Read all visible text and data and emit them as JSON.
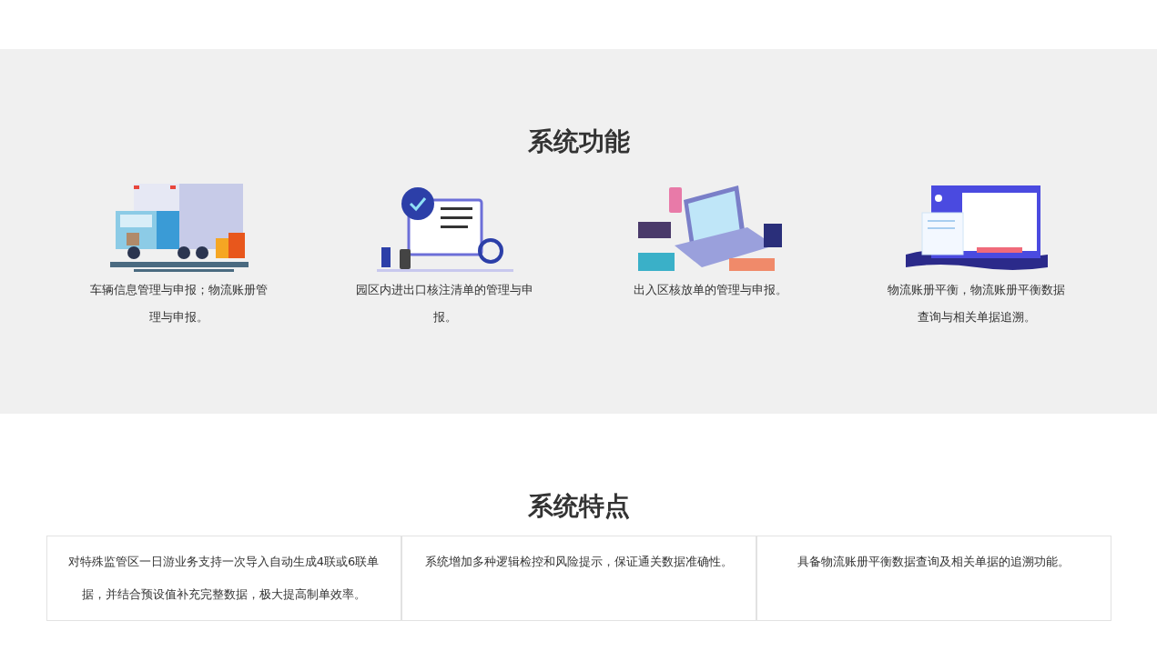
{
  "functions": {
    "title": "系统功能",
    "items": [
      {
        "kind": "truck",
        "text": "车辆信息管理与申报；物流账册管理与申报。"
      },
      {
        "kind": "checklist",
        "text": "园区内进出口核注清单的管理与申报。"
      },
      {
        "kind": "laptop",
        "text": "出入区核放单的管理与申报。"
      },
      {
        "kind": "ledger",
        "text": "物流账册平衡，物流账册平衡数据查询与相关单据追溯。"
      }
    ]
  },
  "features": {
    "title": "系统特点",
    "items": [
      "对特殊监管区一日游业务支持一次导入自动生成4联或6联单据，并结合预设值补充完整数据，极大提高制单效率。",
      "系统增加多种逻辑检控和风险提示，保证通关数据准确性。",
      "具备物流账册平衡数据查询及相关单据的追溯功能。"
    ]
  }
}
